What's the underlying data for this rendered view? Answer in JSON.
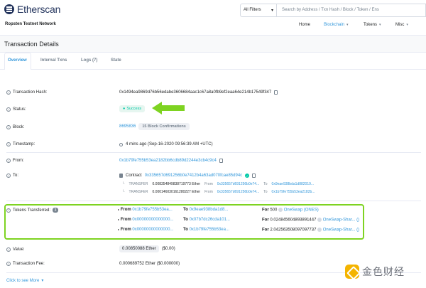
{
  "header": {
    "logo_text": "Etherscan",
    "network": "Ropsten Testnet Network",
    "filter_label": "All Filters",
    "search_placeholder": "Search by Address / Txn Hash / Block / Token / Ens",
    "nav": [
      {
        "label": "Home"
      },
      {
        "label": "Blockchain"
      },
      {
        "label": "Tokens"
      },
      {
        "label": "Misc"
      }
    ]
  },
  "page_title": "Transaction Details",
  "tabs": [
    "Overview",
    "Internal Txns",
    "Logs (7)",
    "State"
  ],
  "rows": {
    "hash": {
      "label": "Transaction Hash:",
      "value": "0x1494ea9869d76b56edabe3606684aac1c67a8a0fb9ef2eaa64e214b17549f347"
    },
    "status": {
      "label": "Status:",
      "value": "Success"
    },
    "block": {
      "label": "Block:",
      "value": "8695836",
      "confirmations": "15 Block Confirmations"
    },
    "timestamp": {
      "label": "Timestamp:",
      "value": "4 mins ago (Sep-16-2020 09:56:39 AM +UTC)"
    },
    "from": {
      "label": "From:",
      "value": "0x1b79fe755b53ea2182bb6cdb89d2244e3cb4c9c4"
    },
    "to": {
      "label": "To:",
      "contract_prefix": "Contract",
      "contract": "0x335657d691256b0e7412b4a63ad070fcae85d94c",
      "transfers": [
        {
          "type": "TRANSFER",
          "amount": "0.008354849838719773 Ether",
          "from_label": "From",
          "from": "0x335657d691256b0e74...",
          "to_label": "To",
          "to": "0x9eae938bda1d882019..."
        },
        {
          "type": "TRANSFER",
          "amount": "0.000146030161280227 Ether",
          "from_label": "From",
          "from": "0x335657d691256b0e74...",
          "to_label": "To",
          "to": "0x1b79fe755b53ea2182b..."
        }
      ]
    },
    "tokens": {
      "label": "Tokens Transferred:",
      "count": "3",
      "items": [
        {
          "from": "0x1b79fe755b53ea...",
          "to": "0x9eae938bda1d8...",
          "amount": "500",
          "token": "OneSwap (ONES)"
        },
        {
          "from": "0x00000000000000...",
          "to": "0x07b7dc26cda101...",
          "amount": "0.024845604893891447",
          "token": "OneSwap-Shar..."
        },
        {
          "from": "0x00000000000000...",
          "to": "0x1b79fe755b53ea...",
          "amount": "2.042563508097097737",
          "token": "OneSwap-Shar..."
        }
      ],
      "from_label": "From",
      "to_label": "To",
      "for_label": "For",
      "paren": "()"
    },
    "value": {
      "label": "Value:",
      "value": "0.00850088 Ether",
      "usd": "($0.00)"
    },
    "fee": {
      "label": "Transaction Fee:",
      "value": "0.000689752 Ether ($0.000000)"
    }
  },
  "click_more": "Click to see More",
  "watermark": "金色财经",
  "colors": {
    "accent": "#3498db",
    "success": "#00c9a7",
    "highlight": "#7ed321"
  }
}
